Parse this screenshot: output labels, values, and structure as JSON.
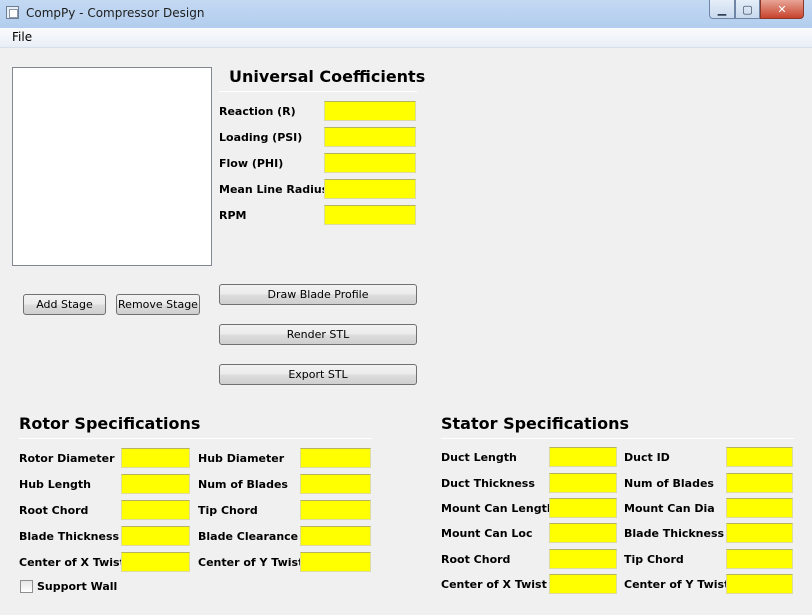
{
  "window": {
    "title": "CompPy - Compressor Design",
    "controls": {
      "minimize": "▁",
      "maximize": "▢",
      "close": "✕"
    },
    "icon": "app-window-icon"
  },
  "menu": {
    "file": "File"
  },
  "stages": {
    "items": [],
    "add_label": "Add Stage",
    "remove_label": "Remove Stage"
  },
  "universal": {
    "title": "Universal Coefficients",
    "reaction_label": "Reaction (R)",
    "loading_label": "Loading (PSI)",
    "flow_label": "Flow (PHI)",
    "mean_radius_label": "Mean Line Radius",
    "rpm_label": "RPM",
    "reaction_value": "",
    "loading_value": "",
    "flow_value": "",
    "mean_radius_value": "",
    "rpm_value": ""
  },
  "actions": {
    "draw_blade": "Draw Blade Profile",
    "render_stl": "Render STL",
    "export_stl": "Export STL"
  },
  "rotor": {
    "title": "Rotor Specifications",
    "rotor_diameter": "Rotor Diameter",
    "hub_diameter": "Hub Diameter",
    "hub_length": "Hub Length",
    "num_blades": "Num of Blades",
    "root_chord": "Root Chord",
    "tip_chord": "Tip Chord",
    "blade_thickness": "Blade Thickness",
    "blade_clearance": "Blade Clearance",
    "center_x_twist": "Center of X Twist",
    "center_y_twist": "Center of Y Twist",
    "support_wall": "Support Wall",
    "support_wall_checked": false
  },
  "stator": {
    "title": "Stator Specifications",
    "duct_length": "Duct Length",
    "duct_id": "Duct ID",
    "duct_thickness": "Duct Thickness",
    "num_blades": "Num of Blades",
    "mount_can_length": "Mount Can Length",
    "mount_can_dia": "Mount Can Dia",
    "mount_can_loc": "Mount Can Loc",
    "blade_thickness": "Blade Thickness",
    "root_chord": "Root Chord",
    "tip_chord": "Tip Chord",
    "center_x_twist": "Center of X Twist",
    "center_y_twist": "Center of Y Twist"
  },
  "colors": {
    "field_background": "#ffff00",
    "window_background": "#f0f0f0",
    "close_button": "#c8432e"
  }
}
